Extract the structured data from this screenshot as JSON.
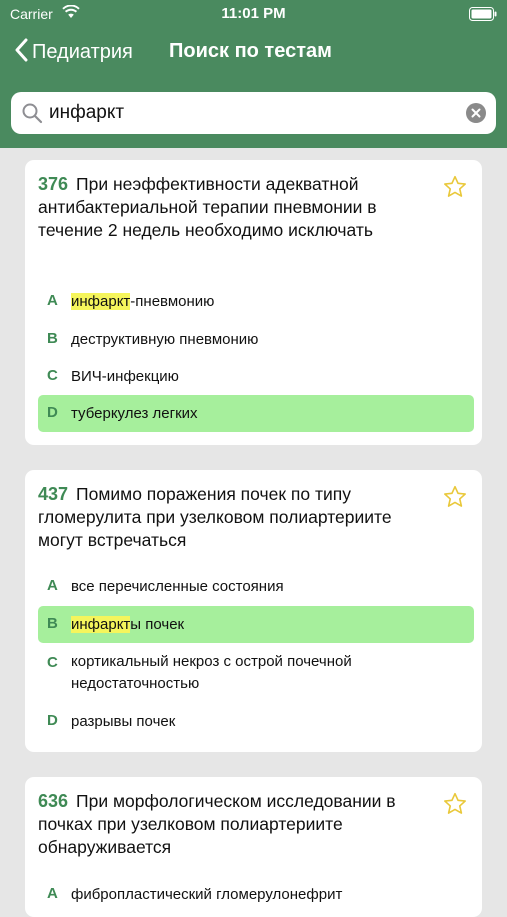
{
  "status_bar": {
    "carrier": "Carrier",
    "time": "11:01 PM"
  },
  "nav": {
    "back_label": "Педиатрия",
    "title": "Поиск по тестам"
  },
  "search": {
    "value": "инфаркт"
  },
  "colors": {
    "header": "#4a8a5f",
    "accent": "#3f8a55",
    "correct": "#a6ef9c",
    "highlight": "#f5f55c"
  },
  "questions": [
    {
      "number": "376",
      "text": "При неэффективности адекватной антибактериальной терапии пневмонии в течение 2 недель необходимо исключать",
      "options": [
        {
          "letter": "A",
          "highlight": "инфаркт",
          "rest": "-пневмонию",
          "text": "",
          "correct": false
        },
        {
          "letter": "B",
          "highlight": "",
          "rest": "",
          "text": "деструктивную пневмонию",
          "correct": false
        },
        {
          "letter": "C",
          "highlight": "",
          "rest": "",
          "text": "ВИЧ-инфекцию",
          "correct": false
        },
        {
          "letter": "D",
          "highlight": "",
          "rest": "",
          "text": "туберкулез легких",
          "correct": true
        }
      ]
    },
    {
      "number": "437",
      "text": "Помимо поражения почек по типу гломерулита при узелковом полиартериите могут встречаться",
      "options": [
        {
          "letter": "A",
          "highlight": "",
          "rest": "",
          "text": "все перечисленные состояния",
          "correct": false
        },
        {
          "letter": "B",
          "highlight": "инфаркт",
          "rest": "ы почек",
          "text": "",
          "correct": true
        },
        {
          "letter": "C",
          "highlight": "",
          "rest": "",
          "text": "кортикальный некроз с острой почечной недостаточностью",
          "correct": false
        },
        {
          "letter": "D",
          "highlight": "",
          "rest": "",
          "text": "разрывы почек",
          "correct": false
        }
      ]
    },
    {
      "number": "636",
      "text": "При морфологическом исследовании в почках при узелковом полиартериите обнаруживается",
      "options": [
        {
          "letter": "A",
          "highlight": "",
          "rest": "",
          "text": "фибропластический гломерулонефрит",
          "correct": false
        }
      ]
    }
  ]
}
